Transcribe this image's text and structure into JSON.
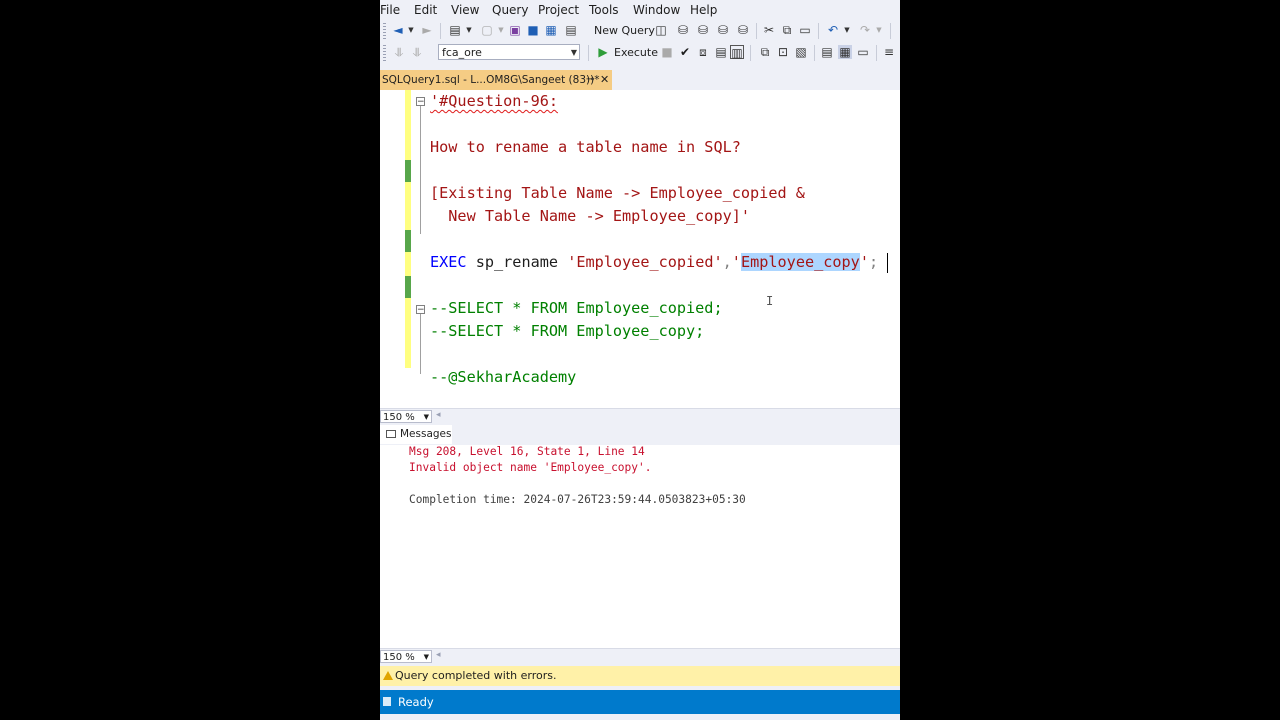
{
  "menu": [
    "File",
    "Edit",
    "View",
    "Query",
    "Project",
    "Tools",
    "Window",
    "Help"
  ],
  "toolbar": {
    "new_query_label": "New Query",
    "database_selected": "fca_ore",
    "execute_label": "Execute"
  },
  "tab": {
    "title": "SQLQuery1.sql - L...OM8G\\Sangeet (83))*",
    "pin_icon": "pin-icon",
    "close_icon": "close-icon"
  },
  "editor": {
    "lines": {
      "l1": "'#Question-96:",
      "l2": "How to rename a table name in SQL?",
      "l3": "[Existing Table Name -> Employee_copied &",
      "l4": "  New Table Name -> Employee_copy]'",
      "l5_kw": "EXEC",
      "l5_proc": "sp_rename",
      "l5_arg1": "'Employee_copied'",
      "l5_comma": ",",
      "l5_q1": "'",
      "l5_sel": "Employee_copy",
      "l5_q2": "'",
      "l5_end": ";",
      "l6": "--SELECT * FROM Employee_copied;",
      "l7": "--SELECT * FROM Employee_copy;",
      "l8": "--@SekharAcademy"
    }
  },
  "zoom": {
    "editor": "150 %",
    "results": "150 %"
  },
  "results": {
    "tab_label": "Messages",
    "msg1": "Msg 208, Level 16, State 1, Line 14",
    "msg2": "Invalid object name 'Employee_copy'.",
    "completion": "Completion time: 2024-07-26T23:59:44.0503823+05:30"
  },
  "status": {
    "query_status": "Query completed with errors.",
    "ready": "Ready"
  },
  "colors": {
    "accent": "#007acc",
    "tab_active": "#f5cc84",
    "string": "#a31515",
    "comment": "#008000",
    "keyword": "#0000ff",
    "error": "#c8102e",
    "warning_bar": "#fff1a8"
  }
}
